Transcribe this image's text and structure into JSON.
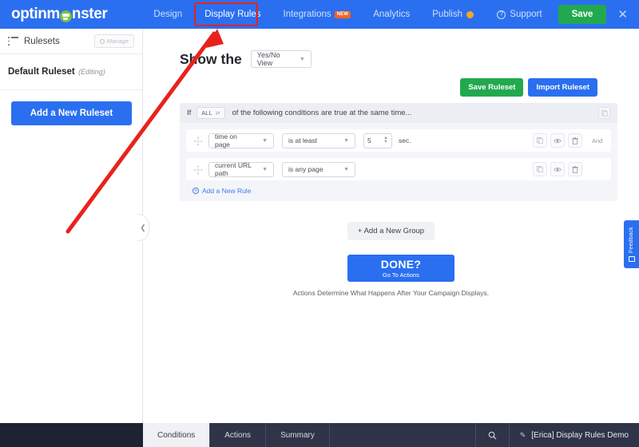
{
  "topnav": {
    "logo_text_1": "optinm",
    "logo_text_2": "nster",
    "menu": [
      {
        "label": "Design",
        "badge": "",
        "active": false
      },
      {
        "label": "Display Rules",
        "badge": "",
        "active": true
      },
      {
        "label": "Integrations",
        "badge": "NEW",
        "active": false
      },
      {
        "label": "Analytics",
        "badge": "",
        "active": false
      },
      {
        "label": "Publish",
        "badge": "",
        "active": false
      }
    ],
    "support_label": "Support",
    "support_icon": "question-circle-icon",
    "save_label": "Save",
    "close_icon": "close-icon",
    "highlight_color": "#e8221b"
  },
  "sidebar": {
    "header_title": "Rulesets",
    "header_icon": "list-icon",
    "manage_label": "Manage",
    "manage_icon": "gear-icon",
    "ruleset_name": "Default Ruleset",
    "ruleset_state": "(Editing)",
    "add_ruleset_label": "Add a New Ruleset",
    "collapse_icon": "chevron-left-icon"
  },
  "main": {
    "show_the_label": "Show the",
    "view_select_value": "Yes/No View",
    "save_ruleset_label": "Save Ruleset",
    "import_ruleset_label": "Import Ruleset",
    "group": {
      "if_label": "If",
      "all_select_value": "ALL",
      "if_text": "of the following conditions are true at the same time...",
      "copy_icon": "copy-icon",
      "rules": [
        {
          "drag_icon": "drag-handle-icon",
          "field": "time on page",
          "operator": "is at least",
          "value": "5",
          "unit": "sec.",
          "has_value_input": true,
          "copy_icon": "copy-icon",
          "preview_icon": "eye-icon",
          "delete_icon": "trash-icon",
          "connector": "And"
        },
        {
          "drag_icon": "drag-handle-icon",
          "field": "current URL path",
          "operator": "is any page",
          "value": "",
          "unit": "",
          "has_value_input": false,
          "copy_icon": "copy-icon",
          "preview_icon": "eye-icon",
          "delete_icon": "trash-icon",
          "connector": ""
        }
      ],
      "add_rule_label": "Add a New Rule",
      "add_rule_icon": "plus-circle-icon"
    },
    "add_group_label": "+ Add a New Group",
    "done_main": "DONE?",
    "done_sub": "Go To Actions",
    "done_note": "Actions Determine What Happens After Your Campaign Displays.",
    "feedback_label": "Feedback",
    "feedback_icon": "comment-icon"
  },
  "bottombar": {
    "tabs": [
      {
        "label": "Conditions",
        "active": true
      },
      {
        "label": "Actions",
        "active": false
      },
      {
        "label": "Summary",
        "active": false
      }
    ],
    "search_icon": "search-icon",
    "campaign_icon": "pencil-icon",
    "campaign_name": "[Erica] Display Rules Demo"
  }
}
